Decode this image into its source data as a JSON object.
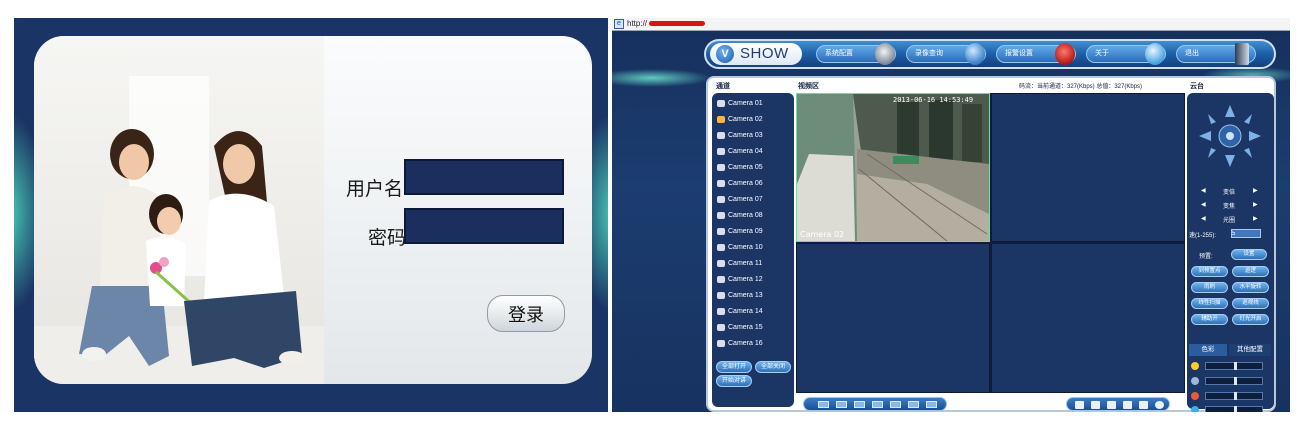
{
  "login": {
    "username_label": "用户名:",
    "username_value": "",
    "password_label": "密码:",
    "password_value": "",
    "login_button": "登录"
  },
  "browser": {
    "address_prefix": "http://"
  },
  "dvr": {
    "brand": "SHOW",
    "nav": [
      {
        "label": "系统配置",
        "icon": "settings-icon"
      },
      {
        "label": "录像查询",
        "icon": "globe-search-icon"
      },
      {
        "label": "报警设置",
        "icon": "alarm-siren-icon"
      },
      {
        "label": "关于",
        "icon": "about-icon"
      },
      {
        "label": "退出",
        "icon": "exit-door-icon"
      }
    ],
    "headers": {
      "channels": "通道",
      "video_area": "视频区",
      "bitrate": "码流：当前通道：327(Kbps) 总值：327(Kbps)",
      "ptz": "云台"
    },
    "cameras": [
      "Camera 01",
      "Camera 02",
      "Camera 03",
      "Camera 04",
      "Camera 05",
      "Camera 06",
      "Camera 07",
      "Camera 08",
      "Camera 09",
      "Camera 10",
      "Camera 11",
      "Camera 12",
      "Camera 13",
      "Camera 14",
      "Camera 15",
      "Camera 16"
    ],
    "active_camera_index": 1,
    "list_buttons": [
      "全部打开",
      "全部关闭",
      "开始对讲"
    ],
    "video": {
      "timestamp": "2013-06-16 14:53:49",
      "overlay_label": "Camera 02"
    },
    "ptz": {
      "zoom": "变倍",
      "focus": "变焦",
      "iris": "光圈",
      "speed_label": "速(1-255):",
      "speed_value": "5",
      "preset_label": "预置:",
      "preset_set": "设置",
      "buttons": [
        "到预置点",
        "巡逻",
        "雨刷",
        "水平旋转",
        "线性扫描",
        "巡视线",
        "辅助开",
        "灯光开启"
      ],
      "tabs": [
        "色彩",
        "其他配置"
      ],
      "sliders": [
        {
          "name": "brightness",
          "icon": "sun-icon",
          "color": "#ffcc2a",
          "level": 0.5
        },
        {
          "name": "contrast",
          "icon": "contrast-icon",
          "color": "#9fb7d6",
          "level": 0.5
        },
        {
          "name": "saturation",
          "icon": "color-wheel-icon",
          "color": "#e85a3a",
          "level": 0.5
        },
        {
          "name": "hue",
          "icon": "hue-icon",
          "color": "#3ab0e8",
          "level": 0.5
        }
      ]
    }
  }
}
